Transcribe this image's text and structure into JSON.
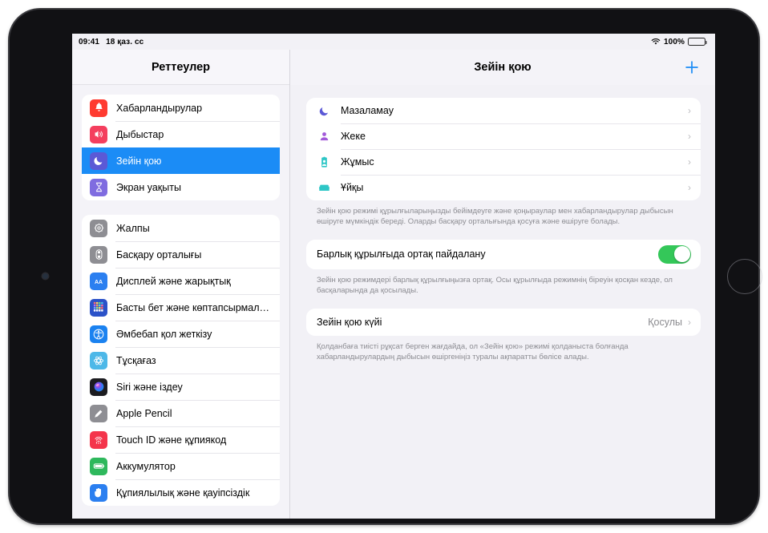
{
  "status_bar": {
    "time": "09:41",
    "date": "18 қаз. сс",
    "wifi_icon": "wifi-icon",
    "battery_percent": "100%",
    "battery_icon": "battery-icon"
  },
  "sidebar": {
    "title": "Реттеулер",
    "groups": [
      {
        "items": [
          {
            "label": "Хабарландырулар",
            "icon": "bell-icon",
            "color": "#ff3b30",
            "selected": false
          },
          {
            "label": "Дыбыстар",
            "icon": "speaker-icon",
            "color": "#f43f5e",
            "selected": false
          },
          {
            "label": "Зейін қою",
            "icon": "moon-icon",
            "color": "#5b59d6",
            "selected": true
          },
          {
            "label": "Экран уақыты",
            "icon": "hourglass-icon",
            "color": "#7f6ce0",
            "selected": false
          }
        ]
      },
      {
        "items": [
          {
            "label": "Жалпы",
            "icon": "gear-icon",
            "color": "#8e8e93",
            "selected": false
          },
          {
            "label": "Басқару орталығы",
            "icon": "control-center-icon",
            "color": "#8e8e93",
            "selected": false
          },
          {
            "label": "Дисплей және жарықтық",
            "icon": "display-brightness-icon",
            "color": "#2b7ff0",
            "selected": false
          },
          {
            "label": "Басты бет және көптапсырмал…",
            "icon": "home-multitasking-icon",
            "color": "#2b52c8",
            "selected": false
          },
          {
            "label": "Әмбебап қол жеткізу",
            "icon": "accessibility-icon",
            "color": "#1b82f0",
            "selected": false
          },
          {
            "label": "Тұсқағаз",
            "icon": "wallpaper-icon",
            "color": "#4db8e8",
            "selected": false
          },
          {
            "label": "Siri және іздеу",
            "icon": "siri-icon",
            "color": "#1c1c20",
            "selected": false
          },
          {
            "label": "Apple Pencil",
            "icon": "pencil-icon",
            "color": "#8e8e93",
            "selected": false
          },
          {
            "label": "Touch ID және құпиякод",
            "icon": "touch-id-icon",
            "color": "#f4344b",
            "selected": false
          },
          {
            "label": "Аккумулятор",
            "icon": "battery-app-icon",
            "color": "#2eb85c",
            "selected": false
          },
          {
            "label": "Құпиялылық және қауіпсіздік",
            "icon": "privacy-hand-icon",
            "color": "#2b7ff0",
            "selected": false
          }
        ]
      }
    ]
  },
  "detail": {
    "title": "Зейін қою",
    "add_button_label": "+",
    "add_button_icon": "plus-icon",
    "accent_color": "#1b8cf6",
    "focus_modes": [
      {
        "label": "Мазаламау",
        "icon": "moon-icon",
        "color": "#5b59d6",
        "chevron": "›"
      },
      {
        "label": "Жеке",
        "icon": "person-icon",
        "color": "#a259d9",
        "chevron": "›"
      },
      {
        "label": "Жұмыс",
        "icon": "work-badge-icon",
        "color": "#2ec6c6",
        "chevron": "›"
      },
      {
        "label": "Ұйқы",
        "icon": "bed-icon",
        "color": "#2ec6c6",
        "chevron": "›"
      }
    ],
    "focus_footnote": "Зейін қою режимі құрылғыларыңызды бейімдеуге және қоңыраулар мен хабарландырулар дыбысын өшіруге мүмкіндік береді. Оларды басқару орталығында қосуға және өшіруге болады.",
    "share_row": {
      "label": "Барлық құрылғыда ортақ пайдалану",
      "toggle_on": true,
      "toggle_color": "#34c759"
    },
    "share_footnote": "Зейін қою режимдері барлық құрылғыңызға ортақ. Осы құрылғыда режимнің біреуін қосқан кезде, ол басқаларында да қосылады.",
    "status_row": {
      "label": "Зейін қою күйі",
      "value": "Қосулы",
      "chevron": "›"
    },
    "status_footnote": "Қолданбаға тиісті рұқсат берген жағдайда, ол «Зейін қою» режимі қолданыста болғанда хабарландырулардың дыбысын өшіргеніңіз туралы ақпаратты бөлісе алады."
  }
}
